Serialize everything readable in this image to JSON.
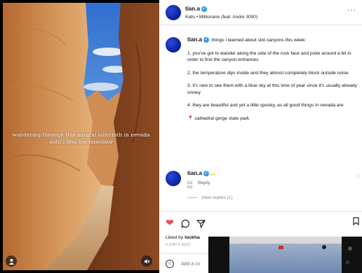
{
  "media": {
    "overlay_caption_line1": "wandering through this natural labyrinth in nevada",
    "overlay_caption_line2": "until i find the minotaur",
    "user_icon": "user-icon",
    "mute_icon": "muted-speaker-icon"
  },
  "header": {
    "username": "tian.a",
    "audio": "Kelis • Millionaire (feat. André 3000)",
    "more": "···"
  },
  "caption": {
    "username": "tian.a",
    "intro": "things i learned about slot canyons this week:",
    "items": [
      "1. you've got to wander along the side of the rock face and poke around a bit in order to find the canyon entrances",
      "2. the temperature dips inside and they almost completely block outside noise",
      "3. it's rare to see them with a blue sky at this time of year since it's usually already snowy",
      "4. they are beautiful and yet a little spooky, as all good things in nevada are"
    ],
    "location": "cathedral gorge state park",
    "time": "6d"
  },
  "comment": {
    "username": "tian.a",
    "time": "6d",
    "reply_label": "Reply",
    "view_replies": "View replies (1)"
  },
  "actions": {
    "liked_by_prefix": "Liked by",
    "liked_by_user": "lockha",
    "date": "6 DAYS AGO"
  },
  "add_comment": {
    "placeholder": "Add a co"
  },
  "colors": {
    "heart": "#ed4956",
    "verified": "#3897f0",
    "avatar": "#0a1f9c"
  }
}
